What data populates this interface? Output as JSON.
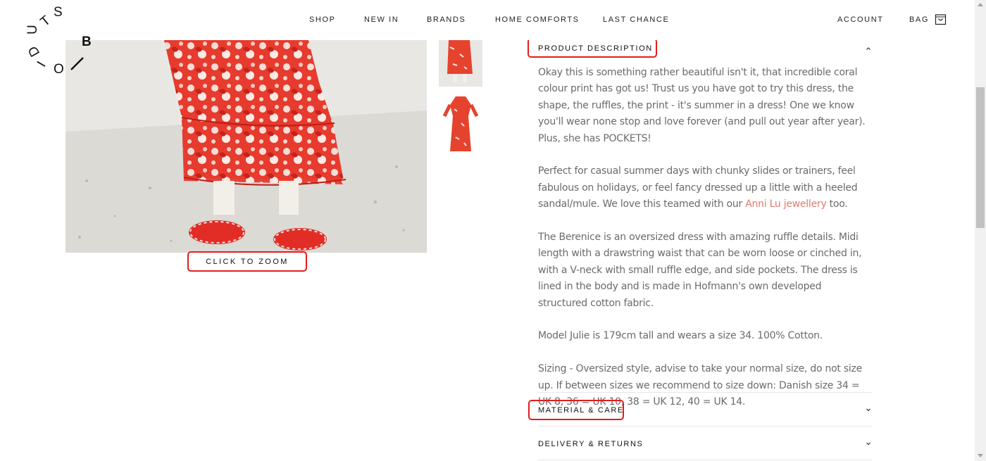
{
  "brand": {
    "logo_letters": [
      "S",
      "T",
      "U",
      "D",
      "I",
      "O",
      "B"
    ]
  },
  "nav": {
    "items": [
      {
        "label": "SHOP"
      },
      {
        "label": "NEW IN"
      },
      {
        "label": "BRANDS"
      },
      {
        "label": "HOME COMFORTS"
      },
      {
        "label": "LAST CHANCE"
      }
    ],
    "account_label": "ACCOUNT",
    "bag_label": "BAG",
    "bag_icon": "shopping-bag-icon"
  },
  "gallery": {
    "zoom_label": "CLICK TO ZOOM",
    "main_image": "model-wearing-coral-floral-ruffle-dress-image",
    "thumbnails": [
      "dress-on-model-thumbnail",
      "dress-flat-thumbnail"
    ]
  },
  "accordion": {
    "description": {
      "title": "PRODUCT DESCRIPTION",
      "expanded": true,
      "p1": "Okay this is something rather beautiful isn't it, that incredible coral colour print has got us! Trust us you have got to try this dress, the shape, the ruffles, the print - it's summer in a dress! One we know you'll wear none stop and love forever (and pull out year after year). Plus, she has POCKETS!",
      "p2_before": "Perfect for casual summer days with chunky slides or trainers, feel fabulous on holidays, or feel fancy dressed up a little with a heeled sandal/mule. We love this teamed with our ",
      "p2_link": "Anni Lu jewellery",
      "p2_after": " too.",
      "p3": "The Berenice is an oversized dress with amazing ruffle details. Midi length with a drawstring waist that can be worn loose or cinched in, with a V-neck with small ruffle edge, and side pockets. The dress is lined in the body and is made in Hofmann's own developed structured cotton fabric.",
      "p4": "Model Julie is 179cm tall and wears a size 34. 100% Cotton.",
      "p5": "Sizing - Oversized style, advise to take your normal size, do not size up. If between sizes we recommend to size down: Danish size 34 = UK 8, 36 = UK 10, 38 = UK 12, 40 = UK 14."
    },
    "material": {
      "title": "MATERIAL & CARE",
      "expanded": false
    },
    "delivery": {
      "title": "DELIVERY & RETURNS",
      "expanded": false
    }
  },
  "colors": {
    "highlight": "#e41c1c",
    "link": "#e07a6e",
    "body_text": "#6b6b6b"
  }
}
